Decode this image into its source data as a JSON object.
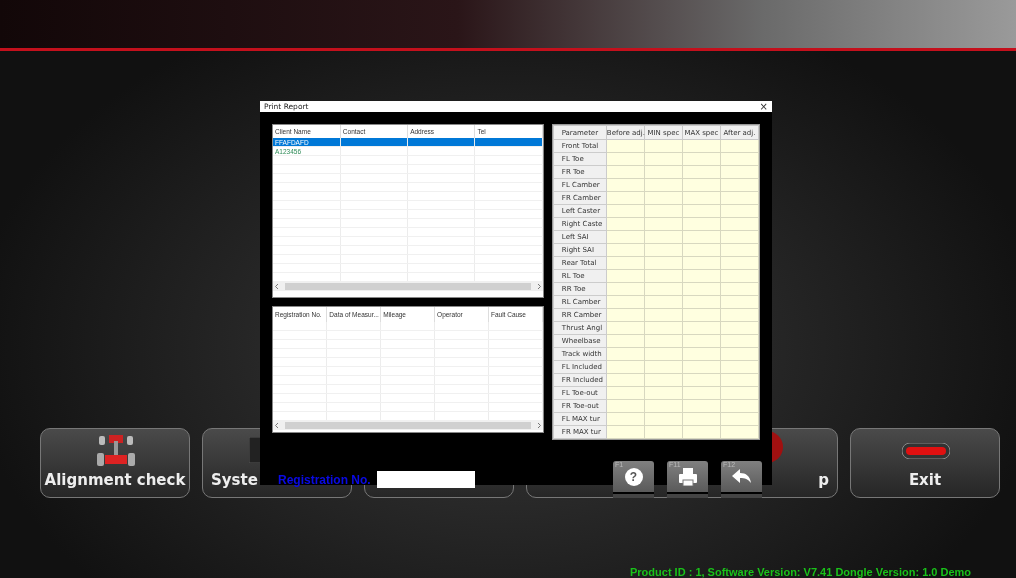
{
  "tiles": [
    {
      "kind": "chassis",
      "label": "Alignment check"
    },
    {
      "kind": "screen",
      "label": "Syste"
    },
    {
      "kind": "plain"
    },
    {
      "kind": "plain"
    },
    {
      "kind": "sphere",
      "label": "p"
    },
    {
      "kind": "exit",
      "label": "Exit"
    }
  ],
  "dialog": {
    "title": "Print Report",
    "close": "×",
    "clients": {
      "columns": [
        "Client Name",
        "Contact",
        "Address",
        "Tel"
      ],
      "rows": [
        {
          "name": "FFAFDAFD",
          "selected": true
        },
        {
          "name": "A123456",
          "selected": false
        }
      ]
    },
    "records": {
      "columns": [
        "Registration No.",
        "Data of Measur...",
        "Mileage",
        "Operator",
        "Fault Cause"
      ]
    },
    "parameters": {
      "columns": [
        "Parameter",
        "Before adj.",
        "MIN spec",
        "MAX spec",
        "After adj."
      ],
      "rows": [
        "Front Total",
        "FL Toe",
        "FR Toe",
        "FL Camber",
        "FR Camber",
        "Left Caster",
        "Right Caste",
        "Left SAI",
        "Right SAI",
        "Rear Total",
        "RL Toe",
        "RR Toe",
        "RL Camber",
        "RR Camber",
        "Thrust Angl",
        "Wheelbase",
        "Track width",
        "FL Included",
        "FR Included",
        "FL Toe-out",
        "FR Toe-out",
        "FL MAX tur",
        "FR MAX tur"
      ]
    },
    "registration": {
      "label": "Registration No."
    },
    "keys": [
      {
        "key": "F1",
        "kind": "help",
        "symbol": "?"
      },
      {
        "key": "F11",
        "kind": "print"
      },
      {
        "key": "F12",
        "kind": "back"
      }
    ]
  },
  "status_bar": "Product ID : 1, Software Version: V7.41 Dongle Version: 1.0 Demo"
}
